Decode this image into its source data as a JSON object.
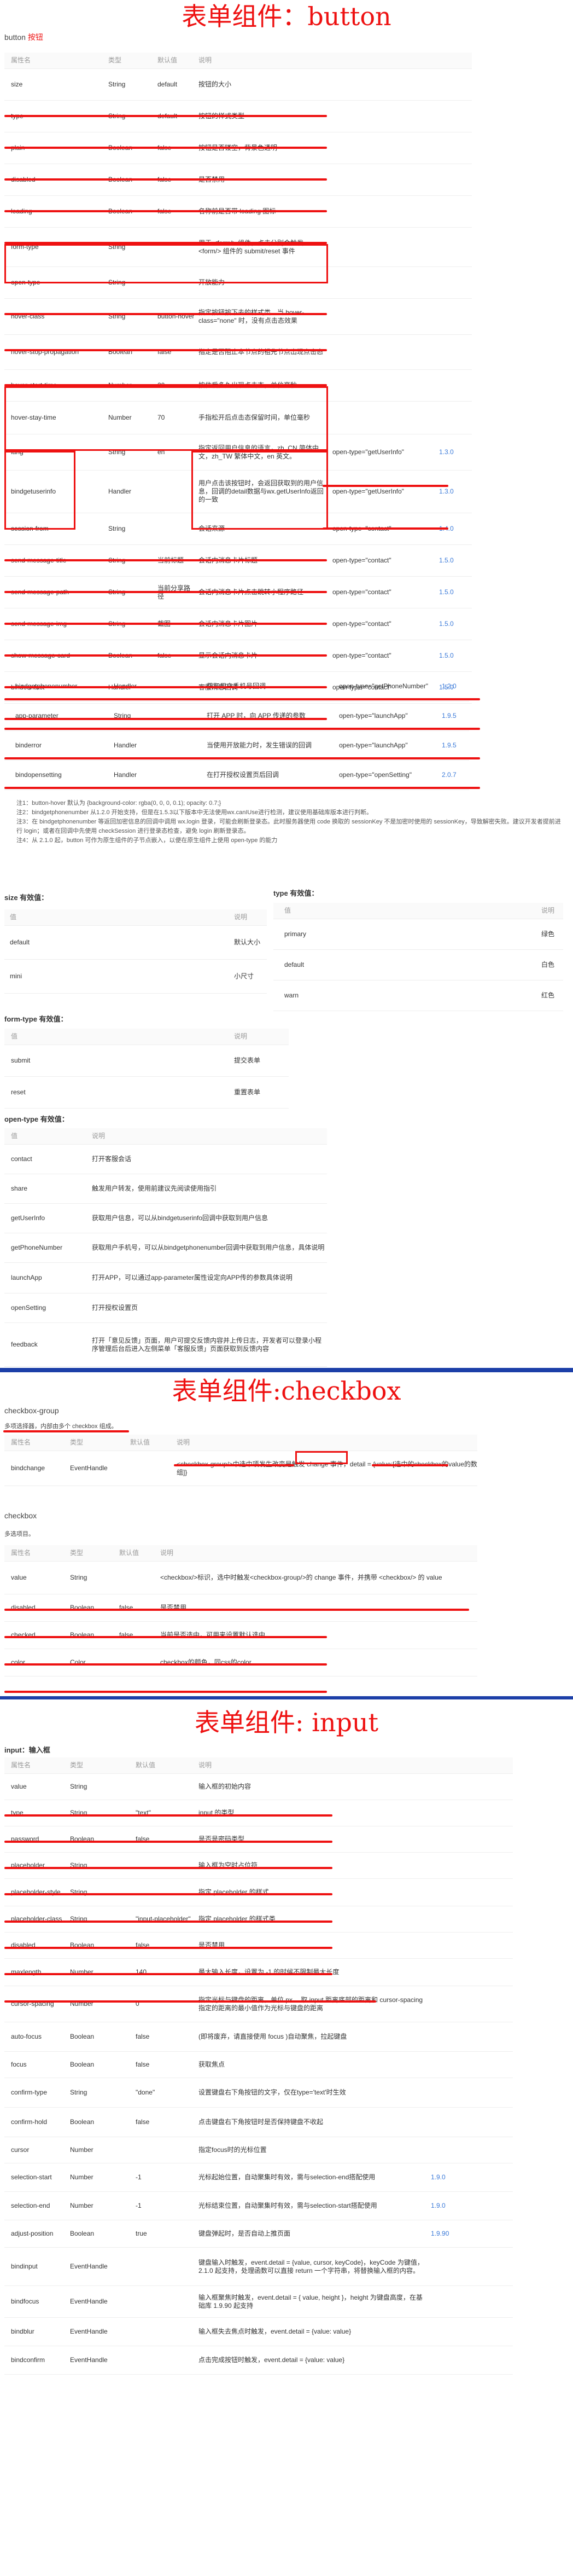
{
  "sections": {
    "button_title": "表单组件：button",
    "checkbox_title": "表单组件:checkbox",
    "input_title": "表单组件: input"
  },
  "button": {
    "heading": "button",
    "heading_tag": "按钮",
    "headers": [
      "属性名",
      "类型",
      "默认值",
      "说明",
      "",
      ""
    ],
    "rows": [
      [
        "size",
        "String",
        "default",
        "按钮的大小",
        "",
        ""
      ],
      [
        "type",
        "String",
        "default",
        "按钮的样式类型",
        "",
        ""
      ],
      [
        "plain",
        "Boolean",
        "false",
        "按钮是否镂空，背景色透明",
        "",
        ""
      ],
      [
        "disabled",
        "Boolean",
        "false",
        "是否禁用",
        "",
        ""
      ],
      [
        "loading",
        "Boolean",
        "false",
        "名称前是否带 loading 图标",
        "",
        ""
      ],
      [
        "form-type",
        "String",
        "",
        "用于 <form/> 组件，点击分别会触发 <form/> 组件的 submit/reset 事件",
        "",
        ""
      ],
      [
        "open-type",
        "String",
        "",
        "开放能力",
        "",
        ""
      ],
      [
        "hover-class",
        "String",
        "button-hover",
        "指定按钮按下去的样式类。当 hover-class=\"none\" 时，没有点击态效果",
        "",
        ""
      ],
      [
        "hover-stop-propagation",
        "Boolean",
        "false",
        "指定是否阻止本节点的祖先节点出现点击态",
        "",
        ""
      ],
      [
        "hover-start-time",
        "Number",
        "20",
        "按住后多久出现点击态，单位毫秒",
        "",
        ""
      ],
      [
        "hover-stay-time",
        "Number",
        "70",
        "手指松开后点击态保留时间，单位毫秒",
        "",
        ""
      ],
      [
        "lang",
        "String",
        "en",
        "指定返回用户信息的语言，zh_CN 简体中文，zh_TW 繁体中文，en 英文。",
        "open-type=\"getUserInfo\"",
        "1.3.0"
      ],
      [
        "bindgetuserinfo",
        "Handler",
        "",
        "用户点击该按钮时，会返回获取到的用户信息，回调的detail数据与wx.getUserInfo返回的一致",
        "open-type=\"getUserInfo\"",
        "1.3.0"
      ],
      [
        "session-from",
        "String",
        "",
        "会话来源",
        "open-type=\"contact\"",
        "1.4.0"
      ],
      [
        "send-message-title",
        "String",
        "当前标题",
        "会话内消息卡片标题",
        "open-type=\"contact\"",
        "1.5.0"
      ],
      [
        "send-message-path",
        "String",
        "当前分享路径",
        "会话内消息卡片点击跳转小程序路径",
        "open-type=\"contact\"",
        "1.5.0"
      ],
      [
        "send-message-img",
        "String",
        "截图",
        "会话内消息卡片图片",
        "open-type=\"contact\"",
        "1.5.0"
      ],
      [
        "show-message-card",
        "Boolean",
        "false",
        "显示会话内消息卡片",
        "open-type=\"contact\"",
        "1.5.0"
      ],
      [
        "bindcontact",
        "Handler",
        "",
        "客服消息回调",
        "open-type=\"contact\"",
        "1.5.0"
      ]
    ],
    "rows2": [
      [
        "bindgetphonenumber",
        "Handler",
        "",
        "获取用户手机号回调",
        "open-type=\"getPhoneNumber\"",
        "1.2.0"
      ],
      [
        "app-parameter",
        "String",
        "",
        "打开 APP 时，向 APP 传递的参数",
        "open-type=\"launchApp\"",
        "1.9.5"
      ],
      [
        "binderror",
        "Handler",
        "",
        "当使用开放能力时，发生错误的回调",
        "open-type=\"launchApp\"",
        "1.9.5"
      ],
      [
        "bindopensetting",
        "Handler",
        "",
        "在打开授权设置页后回调",
        "open-type=\"openSetting\"",
        "2.0.7"
      ]
    ],
    "notes": [
      "注1：button-hover 默认为 {background-color: rgba(0, 0, 0, 0.1); opacity: 0.7;}",
      "注2：bindgetphonenumber 从1.2.0 开始支持，但是在1.5.3以下版本中无法使用wx.canIUse进行检测，建议使用基础库版本进行判断。",
      "注3：在 bindgetphonenumber 等返回加密信息的回调中调用 wx.login 登录，可能会刷新登录态。此时服务器使用 code 换取的 sessionKey 不是加密时使用的 sessionKey，导致解密失败。建议开发者提前进行 login；或者在回调中先使用 checkSession 进行登录态检查，避免 login 刷新登录态。",
      "注4：从 2.1.0 起，button 可作为原生组件的子节点嵌入，以便在原生组件上使用 open-type 的能力"
    ]
  },
  "size_valid": {
    "title": "size 有效值：",
    "headers": [
      "值",
      "说明"
    ],
    "rows": [
      [
        "default",
        "默认大小"
      ],
      [
        "mini",
        "小尺寸"
      ]
    ]
  },
  "type_valid": {
    "title": "type 有效值：",
    "headers": [
      "值",
      "说明"
    ],
    "rows": [
      [
        "primary",
        "绿色"
      ],
      [
        "default",
        "白色"
      ],
      [
        "warn",
        "红色"
      ]
    ]
  },
  "formtype_valid": {
    "title": "form-type 有效值：",
    "headers": [
      "值",
      "说明"
    ],
    "rows": [
      [
        "submit",
        "提交表单"
      ],
      [
        "reset",
        "重置表单"
      ]
    ]
  },
  "opentype_valid": {
    "title": "open-type 有效值：",
    "headers": [
      "值",
      "说明"
    ],
    "rows": [
      [
        "contact",
        "打开客服会话"
      ],
      [
        "share",
        "触发用户转发，使用前建议先阅读使用指引"
      ],
      [
        "getUserInfo",
        "获取用户信息，可以从bindgetuserinfo回调中获取到用户信息"
      ],
      [
        "getPhoneNumber",
        "获取用户手机号，可以从bindgetphonenumber回调中获取到用户信息，具体说明"
      ],
      [
        "launchApp",
        "打开APP，可以通过app-parameter属性设定向APP传的参数具体说明"
      ],
      [
        "openSetting",
        "打开授权设置页"
      ],
      [
        "feedback",
        "打开「意见反馈」页面，用户可提交反馈内容并上传日志，开发者可以登录小程序管理后台后进入左侧菜单「客服反馈」页面获取到反馈内容"
      ]
    ]
  },
  "checkbox_group": {
    "heading": "checkbox-group",
    "desc": "多项选择器，内部由多个 checkbox 组成。",
    "headers": [
      "属性名",
      "类型",
      "默认值",
      "说明"
    ],
    "row": [
      "bindchange",
      "EventHandle",
      "",
      "<checkbox-group/>中选中项发生改变是触发 change 事件，detail = {value:[选中的checkbox的value的数组]}"
    ]
  },
  "checkbox": {
    "heading": "checkbox",
    "desc": "多选项目。",
    "headers": [
      "属性名",
      "类型",
      "默认值",
      "说明"
    ],
    "rows": [
      [
        "value",
        "String",
        "",
        "<checkbox/>标识，选中时触发<checkbox-group/>的 change 事件，并携带 <checkbox/> 的 value"
      ],
      [
        "disabled",
        "Boolean",
        "false",
        "是否禁用"
      ],
      [
        "checked",
        "Boolean",
        "false",
        "当前是否选中，可用来设置默认选中"
      ],
      [
        "color",
        "Color",
        "",
        "checkbox的颜色，同css的color"
      ]
    ]
  },
  "input": {
    "heading": "input：输入框",
    "headers": [
      "属性名",
      "类型",
      "默认值",
      "说明",
      "",
      ""
    ],
    "rows": [
      [
        "value",
        "String",
        "",
        "输入框的初始内容",
        "",
        ""
      ],
      [
        "type",
        "String",
        "\"text\"",
        "input 的类型",
        "",
        ""
      ],
      [
        "password",
        "Boolean",
        "false",
        "是否是密码类型",
        "",
        ""
      ],
      [
        "placeholder",
        "String",
        "",
        "输入框为空时占位符",
        "",
        ""
      ],
      [
        "placeholder-style",
        "String",
        "",
        "指定 placeholder 的样式",
        "",
        ""
      ],
      [
        "placeholder-class",
        "String",
        "\"input-placeholder\"",
        "指定 placeholder 的样式类",
        "",
        ""
      ],
      [
        "disabled",
        "Boolean",
        "false",
        "是否禁用",
        "",
        ""
      ],
      [
        "maxlength",
        "Number",
        "140",
        "最大输入长度，设置为 -1 的时候不限制最大长度",
        "",
        ""
      ],
      [
        "cursor-spacing",
        "Number",
        "0",
        "指定光标与键盘的距离，单位 px 。取 input 距离底部的距离和 cursor-spacing 指定的距离的最小值作为光标与键盘的距离",
        "",
        ""
      ],
      [
        "auto-focus",
        "Boolean",
        "false",
        "(即将废弃，请直接使用 focus )自动聚焦，拉起键盘",
        "",
        ""
      ],
      [
        "focus",
        "Boolean",
        "false",
        "获取焦点",
        "",
        ""
      ],
      [
        "confirm-type",
        "String",
        "\"done\"",
        "设置键盘右下角按钮的文字，仅在type='text'时生效",
        "",
        ""
      ],
      [
        "confirm-hold",
        "Boolean",
        "false",
        "点击键盘右下角按钮时是否保持键盘不收起",
        "",
        ""
      ],
      [
        "cursor",
        "Number",
        "",
        "指定focus时的光标位置",
        "",
        ""
      ],
      [
        "selection-start",
        "Number",
        "-1",
        "光标起始位置，自动聚集时有效，需与selection-end搭配使用",
        "1.9.0",
        ""
      ],
      [
        "selection-end",
        "Number",
        "-1",
        "光标结束位置，自动聚集时有效，需与selection-start搭配使用",
        "1.9.0",
        ""
      ],
      [
        "adjust-position",
        "Boolean",
        "true",
        "键盘弹起时，是否自动上推页面",
        "1.9.90",
        ""
      ],
      [
        "bindinput",
        "EventHandle",
        "",
        "键盘输入时触发，event.detail = {value, cursor, keyCode}，keyCode 为键值，2.1.0 起支持，处理函数可以直接 return 一个字符串，将替换输入框的内容。",
        "",
        ""
      ],
      [
        "bindfocus",
        "EventHandle",
        "",
        "输入框聚焦时触发，event.detail = { value, height }，height 为键盘高度，在基础库 1.9.90 起支持",
        "",
        ""
      ],
      [
        "bindblur",
        "EventHandle",
        "",
        "输入框失去焦点时触发，event.detail = {value: value}",
        "",
        ""
      ],
      [
        "bindconfirm",
        "EventHandle",
        "",
        "点击完成按钮时触发，event.detail = {value: value}",
        "",
        ""
      ]
    ]
  },
  "colors": {
    "accent": "#e11111",
    "divider": "#1c3fa8",
    "link": "#3b7ad9"
  }
}
